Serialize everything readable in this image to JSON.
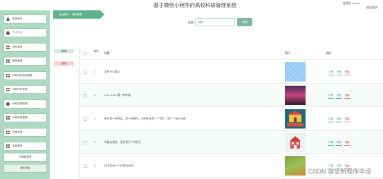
{
  "header": {
    "title": "基于微信小程序的高校科研管理系统",
    "admin": "管理员 admin",
    "logout": "退出登录"
  },
  "sidebar": {
    "items": [
      {
        "label": "系统首页",
        "icon": "house-icon"
      },
      {
        "label": "个人中心",
        "icon": "person-icon"
      },
      {
        "label": "院系管理",
        "icon": "grid-icon"
      },
      {
        "label": "教师管理",
        "icon": "grid-icon"
      },
      {
        "label": "科研项目类型管理",
        "icon": "grid-icon"
      },
      {
        "label": "科研项目管理",
        "icon": "grid-icon"
      },
      {
        "label": "科研成果管理",
        "icon": "bulb-icon"
      },
      {
        "label": "科研获奖管理",
        "icon": "grid-icon"
      },
      {
        "label": "经费申请",
        "icon": "grid-icon"
      },
      {
        "label": "系统管理",
        "icon": "grid-icon"
      }
    ],
    "sub_items": [
      "轮播图管理",
      "通知消息"
    ]
  },
  "breadcrumb": {
    "home": "后台首页",
    "current": "通知消息"
  },
  "search": {
    "label": "标题",
    "placeholder": "标题",
    "button": "查询"
  },
  "actions": {
    "add": "新增",
    "delete": "删除"
  },
  "table": {
    "headers": {
      "index": "索引",
      "title": "标题",
      "image": "图片",
      "ops": "操作"
    },
    "rows": [
      {
        "index": "1",
        "title": "没有什么能比",
        "thumb": "sky"
      },
      {
        "index": "2",
        "title": "Lost of fire 最一种幸福",
        "thumb": "night"
      },
      {
        "index": "3",
        "title": "有不是一种幸运、是一种勇气。日明年还是一个专栏、是一个有价不再",
        "thumb": "school"
      },
      {
        "index": "4",
        "title": "你要去相信、没有到不了的明天",
        "thumb": "house"
      },
      {
        "index": "5",
        "title": "技术是另一个世界的开始",
        "thumb": "road"
      }
    ],
    "ops": {
      "view": "详情",
      "edit": "修改",
      "del": "删除"
    }
  },
  "watermark": "CSDN @全新程序毕设",
  "colors": {
    "sidebar": "#aed9c2",
    "accent": "#5fb38a",
    "button": "#7fb7a4",
    "danger": "#c55"
  }
}
